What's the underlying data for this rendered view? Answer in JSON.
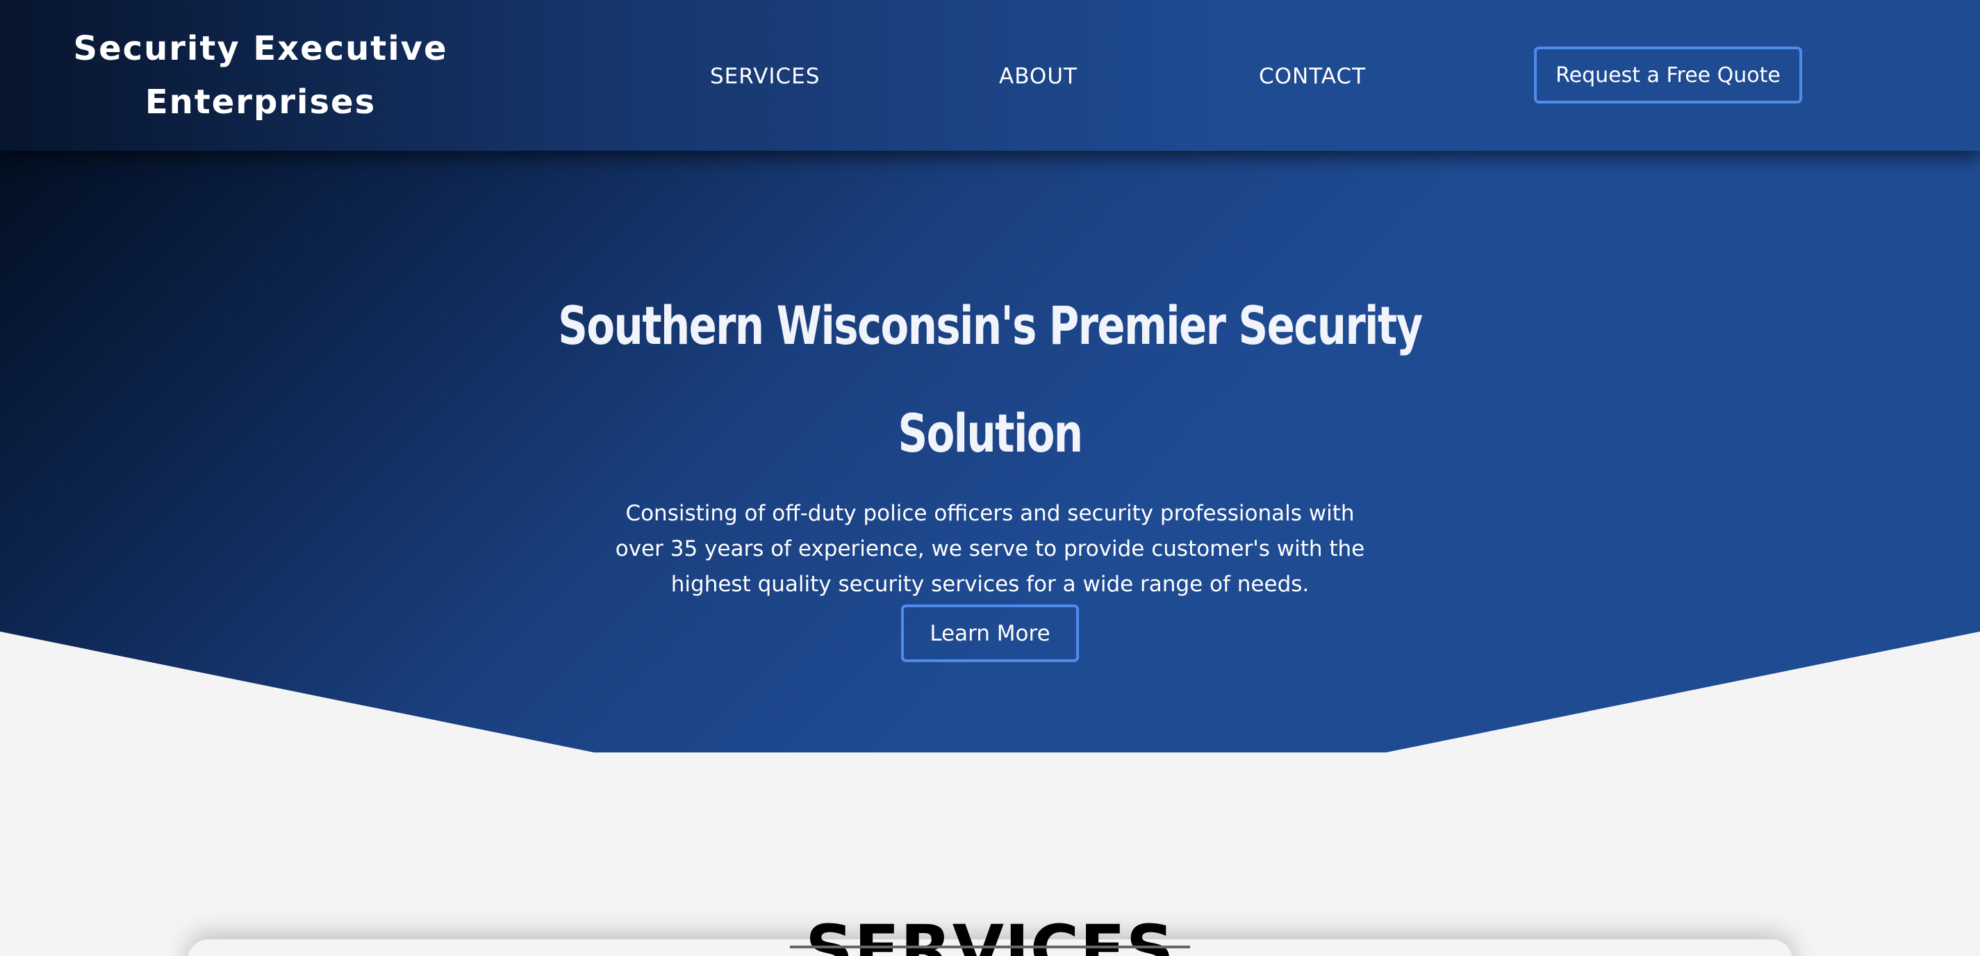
{
  "header": {
    "logo_text": "Security Executive Enterprises",
    "nav": {
      "services": "SERVICES",
      "about": "ABOUT",
      "contact": "CONTACT"
    },
    "cta_label": "Request a Free Quote"
  },
  "hero": {
    "title": "Southern Wisconsin's Premier Security Solution",
    "description": "Consisting of off-duty police officers and security professionals with over 35 years of experience, we serve to provide customer's with the highest quality security services for a wide range of needs.",
    "button_label": "Learn More"
  },
  "services_section": {
    "heading": "SERVICES"
  },
  "colors": {
    "primary_blue": "#1f4b93",
    "dark_navy": "#07152e",
    "button_border": "#4f8be8",
    "section_background": "#f4f4f4"
  }
}
